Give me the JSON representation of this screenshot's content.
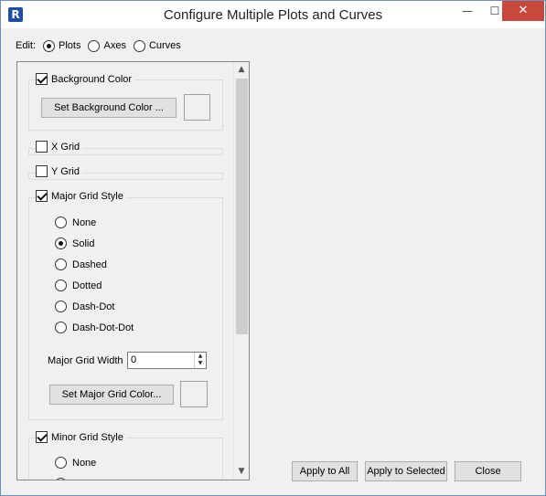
{
  "window": {
    "title": "Configure Multiple Plots and Curves",
    "app_icon": "R",
    "minimize_glyph": "—",
    "maximize_glyph": "☐",
    "close_glyph": "✕"
  },
  "edit": {
    "label": "Edit:",
    "options": [
      {
        "label": "Plots",
        "selected": true
      },
      {
        "label": "Axes",
        "selected": false
      },
      {
        "label": "Curves",
        "selected": false
      }
    ]
  },
  "background": {
    "checkbox_label": "Background Color",
    "checked": true,
    "button_label": "Set Background Color ..."
  },
  "x_grid": {
    "label": "X Grid",
    "checked": false
  },
  "y_grid": {
    "label": "Y Grid",
    "checked": false
  },
  "major_grid": {
    "checkbox_label": "Major Grid Style",
    "checked": true,
    "styles": [
      {
        "label": "None",
        "selected": false
      },
      {
        "label": "Solid",
        "selected": true
      },
      {
        "label": "Dashed",
        "selected": false
      },
      {
        "label": "Dotted",
        "selected": false
      },
      {
        "label": "Dash-Dot",
        "selected": false
      },
      {
        "label": "Dash-Dot-Dot",
        "selected": false
      }
    ],
    "width_label": "Major Grid Width",
    "width_value": "0",
    "color_button_label": "Set Major Grid Color..."
  },
  "minor_grid": {
    "checkbox_label": "Minor Grid Style",
    "checked": true,
    "first_style": "None"
  },
  "buttons": {
    "apply_all": "Apply to All",
    "apply_selected": "Apply to Selected",
    "close": "Close"
  },
  "icons": {
    "scroll_up": "▲",
    "scroll_down": "▼",
    "spin_up": "▲",
    "spin_down": "▼"
  }
}
